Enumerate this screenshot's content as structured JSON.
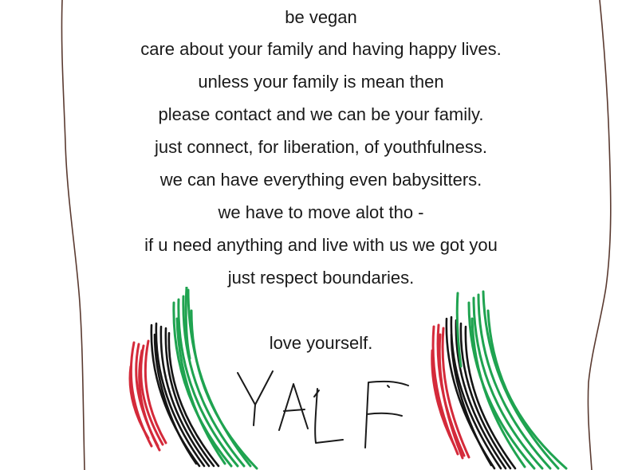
{
  "poem": {
    "lines": [
      "be vegan",
      "care about your family and having happy lives.",
      "unless your family is mean then",
      "please contact and we can be your family.",
      "just connect, for liberation, of youthfulness.",
      "we can have everything even babysitters.",
      "we have to move alot tho -",
      "if u need anything and live with us we got you",
      "just respect boundaries.",
      "love yourself."
    ]
  },
  "signature": {
    "text": "YALF"
  },
  "colors": {
    "ink": "#1a1a1a",
    "paper_border": "#5a3a30",
    "flag_red": "#d42a3a",
    "flag_black": "#151515",
    "flag_green": "#1fa350"
  }
}
